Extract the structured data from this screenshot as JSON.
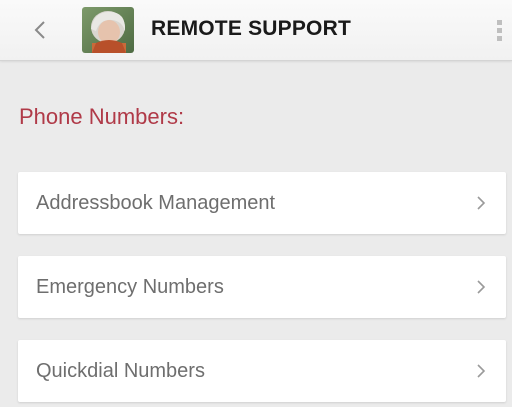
{
  "header": {
    "title": "REMOTE SUPPORT",
    "back_icon": "chevron-left-icon",
    "overflow_icon": "more-vertical-icon",
    "avatar": "user-photo"
  },
  "main": {
    "section_heading": "Phone Numbers:",
    "items": [
      {
        "label": "Addressbook Management",
        "icon": "chevron-right-icon"
      },
      {
        "label": "Emergency Numbers",
        "icon": "chevron-right-icon"
      },
      {
        "label": "Quickdial Numbers",
        "icon": "chevron-right-icon"
      }
    ]
  },
  "colors": {
    "heading": "#b03a48",
    "background": "#ebebeb",
    "card": "#ffffff",
    "item_text": "#6e6e6e"
  }
}
